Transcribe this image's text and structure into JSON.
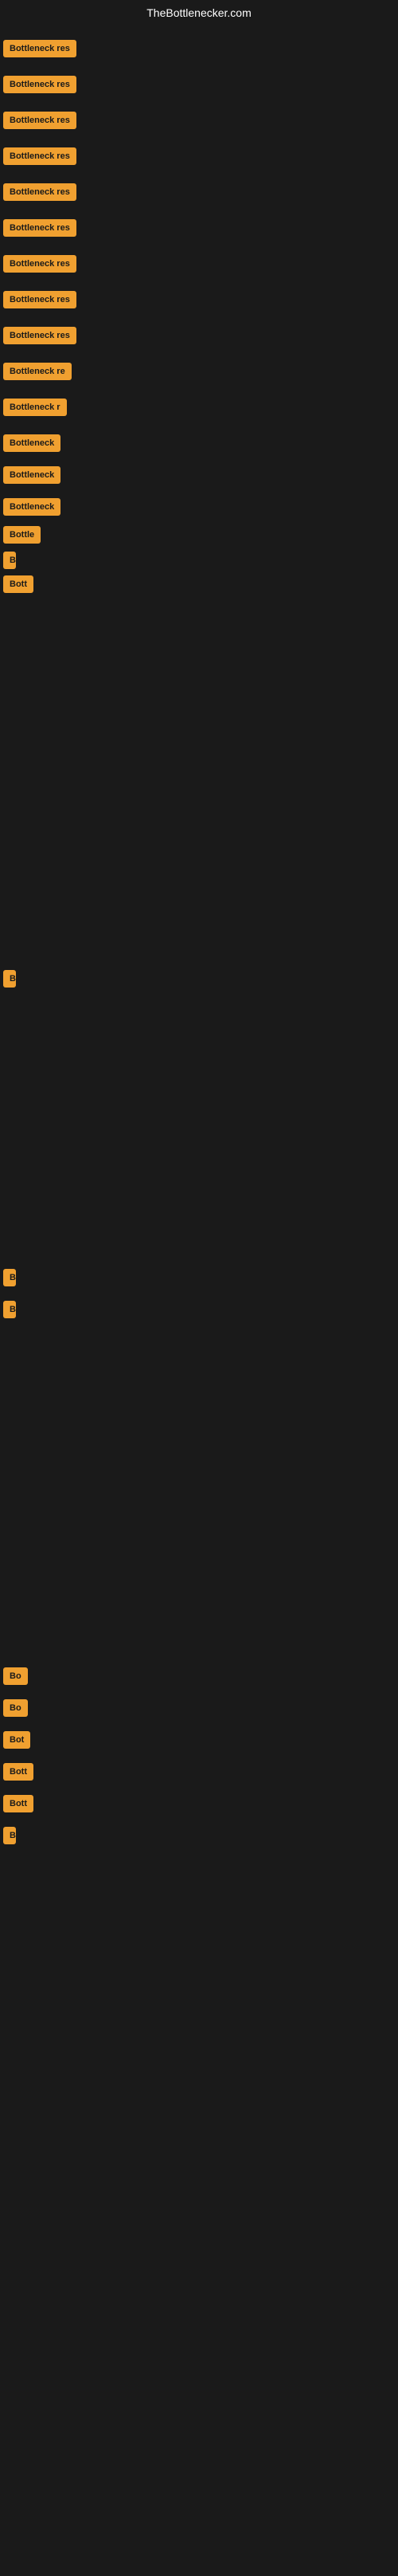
{
  "header": {
    "title": "TheBottlenecker.com"
  },
  "items": [
    {
      "label": "Bottleneck res",
      "width_class": "btn-full"
    },
    {
      "label": "Bottleneck res",
      "width_class": "btn-full"
    },
    {
      "label": "Bottleneck res",
      "width_class": "btn-full"
    },
    {
      "label": "Bottleneck res",
      "width_class": "btn-full"
    },
    {
      "label": "Bottleneck res",
      "width_class": "btn-full"
    },
    {
      "label": "Bottleneck res",
      "width_class": "btn-full"
    },
    {
      "label": "Bottleneck res",
      "width_class": "btn-full"
    },
    {
      "label": "Bottleneck res",
      "width_class": "btn-full"
    },
    {
      "label": "Bottleneck res",
      "width_class": "btn-full"
    },
    {
      "label": "Bottleneck re",
      "width_class": "btn-lg"
    },
    {
      "label": "Bottleneck r",
      "width_class": "btn-md"
    },
    {
      "label": "Bottleneck",
      "width_class": "btn-sm"
    },
    {
      "label": "Bottleneck",
      "width_class": "btn-sm"
    },
    {
      "label": "Bottleneck",
      "width_class": "btn-sm"
    },
    {
      "label": "Bottle",
      "width_class": "btn-xs"
    },
    {
      "label": "B",
      "width_class": "btn-dot"
    },
    {
      "label": "Bott",
      "width_class": "btn-xxs"
    },
    {
      "label": "",
      "width_class": "btn-dot"
    },
    {
      "label": "",
      "width_class": "btn-dot"
    },
    {
      "label": "",
      "width_class": "btn-dot"
    },
    {
      "label": "",
      "width_class": "btn-dot"
    },
    {
      "label": "",
      "width_class": "btn-dot"
    },
    {
      "label": "",
      "width_class": "btn-dot"
    },
    {
      "label": "B",
      "width_class": "btn-dot"
    },
    {
      "label": "",
      "width_class": "btn-dot"
    },
    {
      "label": "",
      "width_class": "btn-dot"
    },
    {
      "label": "",
      "width_class": "btn-dot"
    },
    {
      "label": "",
      "width_class": "btn-dot"
    },
    {
      "label": "",
      "width_class": "btn-dot"
    },
    {
      "label": "",
      "width_class": "btn-dot"
    },
    {
      "label": "B",
      "width_class": "btn-dot"
    },
    {
      "label": "",
      "width_class": "btn-dot"
    },
    {
      "label": "",
      "width_class": "btn-dot"
    },
    {
      "label": "B",
      "width_class": "btn-dot"
    },
    {
      "label": "Bo",
      "width_class": "btn-xxs"
    },
    {
      "label": "Bo",
      "width_class": "btn-xxs"
    },
    {
      "label": "Bot",
      "width_class": "btn-xxs"
    },
    {
      "label": "Bott",
      "width_class": "btn-xxs"
    },
    {
      "label": "Bott",
      "width_class": "btn-xxs"
    },
    {
      "label": "B",
      "width_class": "btn-dot"
    }
  ]
}
